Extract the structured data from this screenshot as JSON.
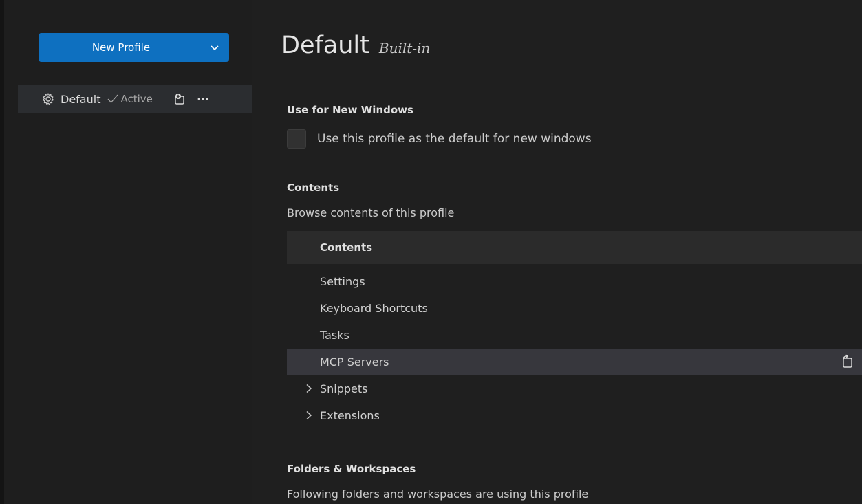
{
  "sidebar": {
    "new_profile_label": "New Profile",
    "profiles": [
      {
        "name": "Default",
        "active_label": "Active"
      }
    ]
  },
  "main": {
    "title": "Default",
    "subtitle": "Built-in",
    "sections": {
      "new_windows": {
        "heading": "Use for New Windows",
        "checkbox_label": "Use this profile as the default for new windows",
        "checked": false
      },
      "contents": {
        "heading": "Contents",
        "description": "Browse contents of this profile",
        "table_header": "Contents",
        "rows": [
          {
            "label": "Settings"
          },
          {
            "label": "Keyboard Shortcuts"
          },
          {
            "label": "Tasks"
          },
          {
            "label": "MCP Servers",
            "selected": true
          },
          {
            "label": "Snippets",
            "expandable": true
          },
          {
            "label": "Extensions",
            "expandable": true
          }
        ]
      },
      "folders": {
        "heading": "Folders & Workspaces",
        "description": "Following folders and workspaces are using this profile"
      }
    }
  },
  "colors": {
    "accent": "#0e70c0",
    "background": "#1f1f1f",
    "selected_row": "#37373d"
  }
}
